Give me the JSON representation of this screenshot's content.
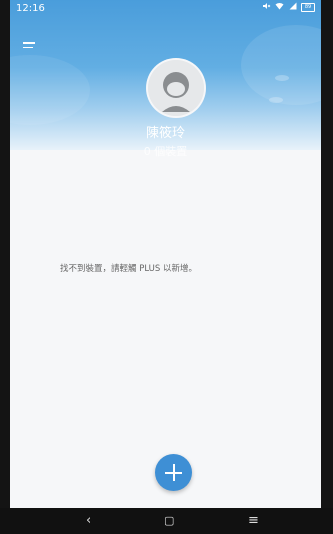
{
  "status_bar": {
    "time": "12:16",
    "battery_level": "89"
  },
  "profile": {
    "name": "陳筱玲",
    "device_count": "0 個裝置"
  },
  "empty_state": {
    "message": "找不到裝置，請輕觸 PLUS 以新增。"
  },
  "colors": {
    "accent": "#3e8fd5",
    "hero_top": "#4a9ddb"
  },
  "icons": {
    "menu": "menu-icon",
    "add": "plus-icon",
    "back": "back-icon",
    "home": "home-icon",
    "recents": "recents-icon"
  }
}
